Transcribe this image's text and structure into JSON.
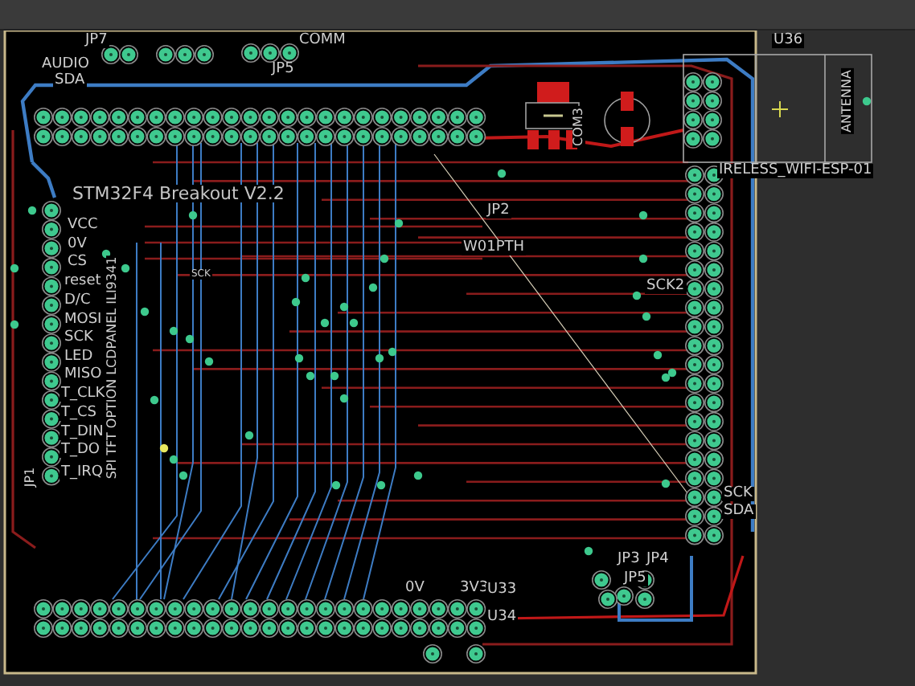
{
  "board": {
    "labels": [
      {
        "text": "JP7",
        "kind": "horizontal"
      },
      {
        "text": "AUDIO",
        "kind": "horizontal"
      },
      {
        "text": "SDA",
        "kind": "horizontal"
      },
      {
        "text": "COMM",
        "kind": "horizontal"
      },
      {
        "text": "JP5",
        "kind": "horizontal"
      },
      {
        "text": "STM32F4 Breakout V2.2",
        "kind": "title"
      },
      {
        "text": "VCC",
        "kind": "horizontal"
      },
      {
        "text": "0V",
        "kind": "horizontal"
      },
      {
        "text": "CS",
        "kind": "horizontal"
      },
      {
        "text": "reset",
        "kind": "horizontal"
      },
      {
        "text": "D/C",
        "kind": "horizontal"
      },
      {
        "text": "MOSI",
        "kind": "horizontal"
      },
      {
        "text": "SCK",
        "kind": "horizontal"
      },
      {
        "text": "LED",
        "kind": "horizontal"
      },
      {
        "text": "MISO",
        "kind": "horizontal"
      },
      {
        "text": "T_CLK",
        "kind": "horizontal"
      },
      {
        "text": "T_CS",
        "kind": "horizontal"
      },
      {
        "text": "T_DIN",
        "kind": "horizontal"
      },
      {
        "text": "T_DO",
        "kind": "horizontal"
      },
      {
        "text": "T_IRQ",
        "kind": "horizontal"
      },
      {
        "text": "SPI TFT OPTION LCDPANEL ILI9341",
        "kind": "vertical"
      },
      {
        "text": "SCK",
        "kind": "small"
      },
      {
        "text": "JP2",
        "kind": "horizontal"
      },
      {
        "text": "W01PTH",
        "kind": "horizontal"
      },
      {
        "text": "COM3",
        "kind": "vertical"
      },
      {
        "text": "U36",
        "kind": "horizontal"
      },
      {
        "text": "ANTENNA",
        "kind": "vertical"
      },
      {
        "text": "IRELESS_WIFI-ESP-01",
        "kind": "horizontal"
      },
      {
        "text": "SCK2",
        "kind": "horizontal"
      },
      {
        "text": "SCK",
        "kind": "horizontal"
      },
      {
        "text": "SDA",
        "kind": "horizontal"
      },
      {
        "text": "JP3",
        "kind": "horizontal"
      },
      {
        "text": "JP4",
        "kind": "horizontal"
      },
      {
        "text": "JP5",
        "kind": "horizontal"
      },
      {
        "text": "0V",
        "kind": "horizontal"
      },
      {
        "text": "3V3",
        "kind": "horizontal"
      },
      {
        "text": "U33",
        "kind": "horizontal"
      },
      {
        "text": "U34",
        "kind": "horizontal"
      },
      {
        "text": "JP1",
        "kind": "vertical"
      }
    ]
  }
}
